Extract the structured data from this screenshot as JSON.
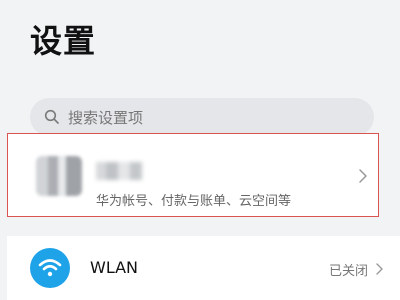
{
  "header": {
    "title": "设置"
  },
  "search": {
    "placeholder": "搜索设置项",
    "icon": "search-icon"
  },
  "account": {
    "subtitle": "华为帐号、付款与账单、云空间等",
    "highlight_color": "#d9534f",
    "icon": "chevron-right-icon"
  },
  "settings_list": [
    {
      "label": "WLAN",
      "status": "已关闭",
      "icon": "wifi-icon",
      "icon_color": "#1fa3e8"
    }
  ]
}
